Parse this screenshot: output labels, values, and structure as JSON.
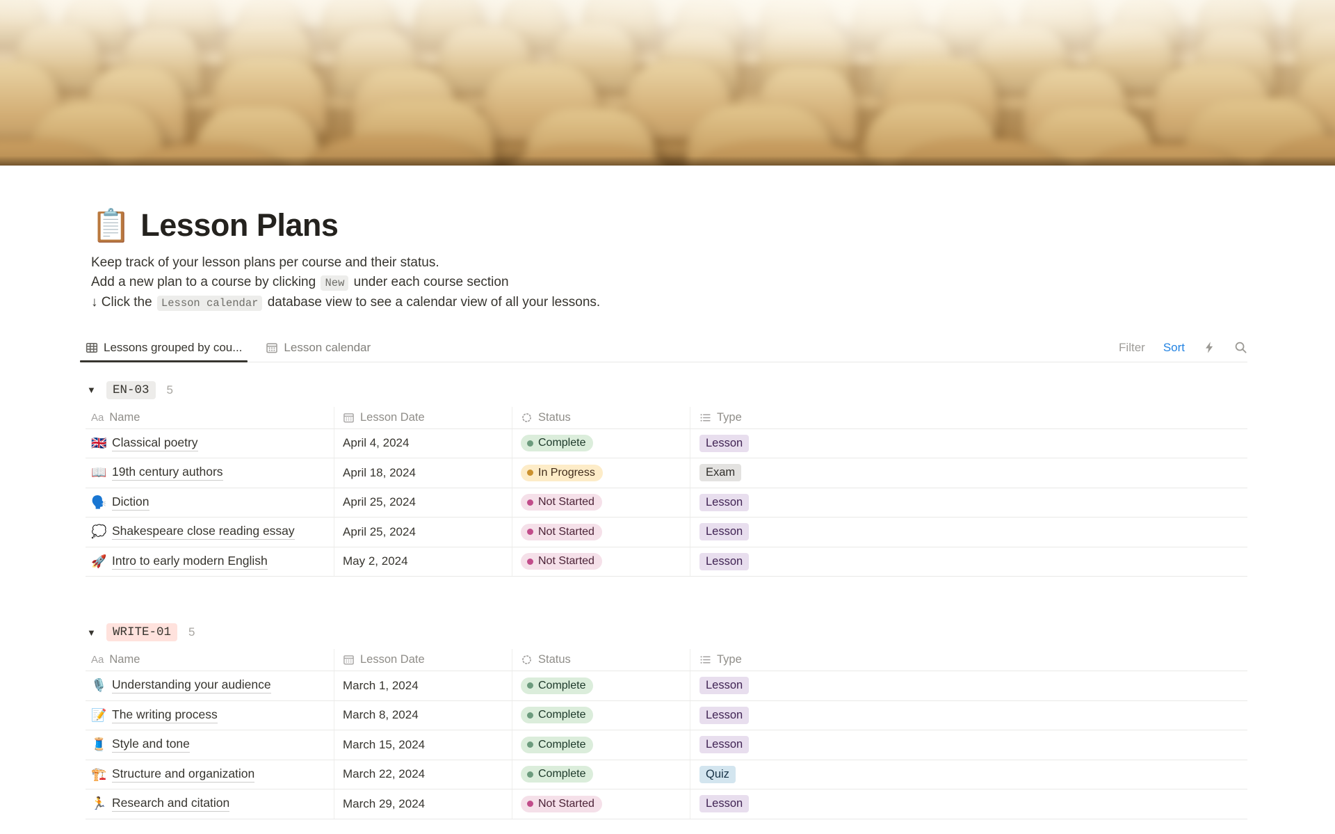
{
  "page": {
    "icon": "📋",
    "title": "Lesson Plans",
    "description": {
      "line1": "Keep track of your lesson plans per course and their status.",
      "line2_before": "Add a new plan to a course by clicking ",
      "line2_code": "New",
      "line2_after": " under each course section",
      "line3_before": "↓ Click the ",
      "line3_code": "Lesson calendar",
      "line3_after": " database view to see a calendar view of all your lessons."
    }
  },
  "tabs": [
    {
      "label": "Lessons grouped by cou...",
      "icon": "table-icon",
      "active": true
    },
    {
      "label": "Lesson calendar",
      "icon": "calendar-icon",
      "active": false
    }
  ],
  "toolbar": {
    "filter": "Filter",
    "sort": "Sort",
    "icons": [
      "lightning-icon",
      "search-icon"
    ],
    "accent_blue": "#2383E2"
  },
  "table": {
    "columns": [
      {
        "label": "Name",
        "icon": "aa-icon"
      },
      {
        "label": "Lesson Date",
        "icon": "calendar-icon"
      },
      {
        "label": "Status",
        "icon": "status-spinner-icon"
      },
      {
        "label": "Type",
        "icon": "list-icon"
      }
    ]
  },
  "groups": [
    {
      "id": "EN-03",
      "badge_bg": "#EDECEA",
      "badge_text": "#37352F",
      "count": "5",
      "rows": [
        {
          "emoji": "🇬🇧",
          "name": "Classical poetry",
          "date": "April 4, 2024",
          "status": "Complete",
          "type": "Lesson"
        },
        {
          "emoji": "📖",
          "name": "19th century authors",
          "date": "April 18, 2024",
          "status": "In Progress",
          "type": "Exam"
        },
        {
          "emoji": "🗣️",
          "name": "Diction",
          "date": "April 25, 2024",
          "status": "Not Started",
          "type": "Lesson"
        },
        {
          "emoji": "💭",
          "name": "Shakespeare close reading essay",
          "date": "April 25, 2024",
          "status": "Not Started",
          "type": "Lesson"
        },
        {
          "emoji": "🚀",
          "name": "Intro to early modern English",
          "date": "May 2, 2024",
          "status": "Not Started",
          "type": "Lesson"
        }
      ]
    },
    {
      "id": "WRITE-01",
      "badge_bg": "#FFE2DD",
      "badge_text": "#37352F",
      "count": "5",
      "rows": [
        {
          "emoji": "🎙️",
          "name": "Understanding your audience",
          "date": "March 1, 2024",
          "status": "Complete",
          "type": "Lesson"
        },
        {
          "emoji": "📝",
          "name": "The writing process",
          "date": "March 8, 2024",
          "status": "Complete",
          "type": "Lesson"
        },
        {
          "emoji": "🧵",
          "name": "Style and tone",
          "date": "March 15, 2024",
          "status": "Complete",
          "type": "Lesson"
        },
        {
          "emoji": "🏗️",
          "name": "Structure and organization",
          "date": "March 22, 2024",
          "status": "Complete",
          "type": "Quiz"
        },
        {
          "emoji": "🏃",
          "name": "Research and citation",
          "date": "March 29, 2024",
          "status": "Not Started",
          "type": "Lesson"
        }
      ]
    }
  ],
  "status_styles": {
    "Complete": {
      "bg": "#DBEDDB",
      "dot": "#6C9B7D",
      "text": "#1C3829"
    },
    "In Progress": {
      "bg": "#FDECC8",
      "dot": "#CB912F",
      "text": "#402C1B"
    },
    "Not Started": {
      "bg": "#F5E0E9",
      "dot": "#C14C8A",
      "text": "#4C2337"
    }
  },
  "type_styles": {
    "Lesson": {
      "bg": "#E8DEEE",
      "text": "#412454"
    },
    "Exam": {
      "bg": "#E3E2E0",
      "text": "#32302C"
    },
    "Quiz": {
      "bg": "#D3E5EF",
      "text": "#183347"
    }
  }
}
